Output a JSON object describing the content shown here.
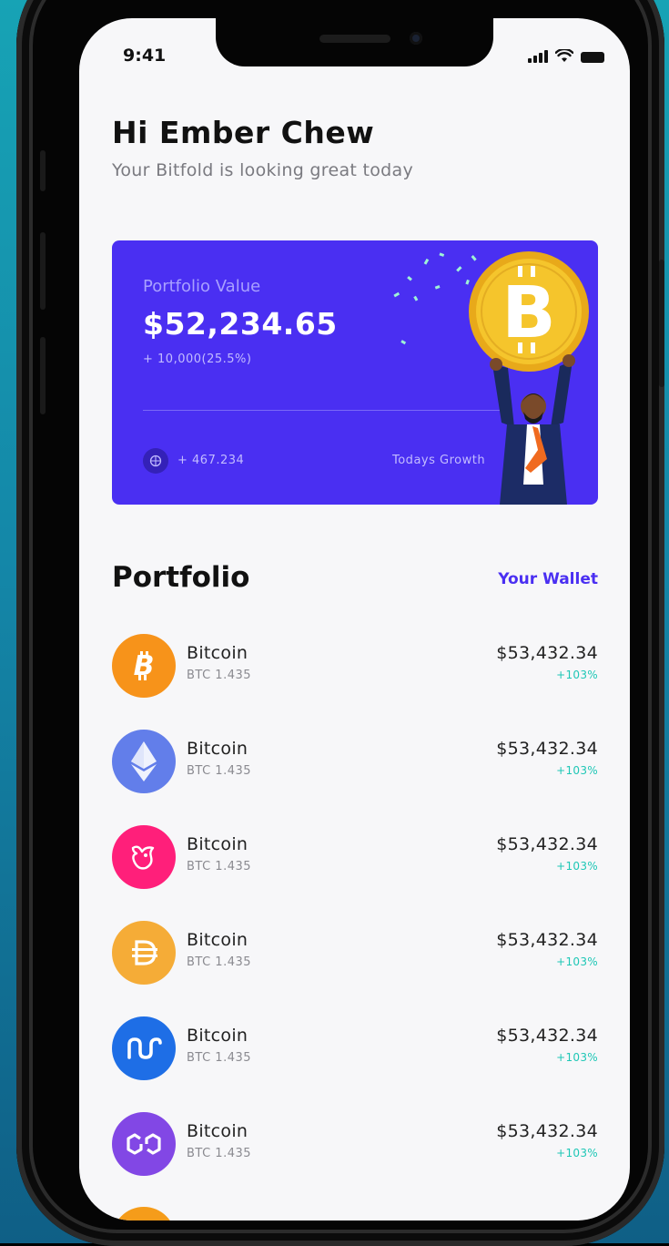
{
  "status_bar": {
    "time": "9:41"
  },
  "header": {
    "greeting": "Hi Ember Chew",
    "subtitle": "Your Bitfold is looking great today"
  },
  "portfolio_card": {
    "label": "Portfolio Value",
    "value": "$52,234.65",
    "change": "+ 10,000(25.5%)",
    "stat": "+ 467.234",
    "growth_label": "Todays Growth",
    "color": "#4a2ff2"
  },
  "portfolio_section": {
    "title": "Portfolio",
    "wallet_link": "Your Wallet"
  },
  "assets": [
    {
      "name": "Bitcoin",
      "amount": "BTC 1.435",
      "value": "$53,432.34",
      "change": "+103%",
      "icon": "bitcoin-icon",
      "color": "#f7931a"
    },
    {
      "name": "Bitcoin",
      "amount": "BTC 1.435",
      "value": "$53,432.34",
      "change": "+103%",
      "icon": "ethereum-icon",
      "color": "#627eea"
    },
    {
      "name": "Bitcoin",
      "amount": "BTC 1.435",
      "value": "$53,432.34",
      "change": "+103%",
      "icon": "uniswap-icon",
      "color": "#ff1f7a"
    },
    {
      "name": "Bitcoin",
      "amount": "BTC 1.435",
      "value": "$53,432.34",
      "change": "+103%",
      "icon": "dai-icon",
      "color": "#f5ac37"
    },
    {
      "name": "Bitcoin",
      "amount": "BTC 1.435",
      "value": "$53,432.34",
      "change": "+103%",
      "icon": "nu-icon",
      "color": "#1e6ee6"
    },
    {
      "name": "Bitcoin",
      "amount": "BTC 1.435",
      "value": "$53,432.34",
      "change": "+103%",
      "icon": "polygon-icon",
      "color": "#8247e5"
    }
  ]
}
